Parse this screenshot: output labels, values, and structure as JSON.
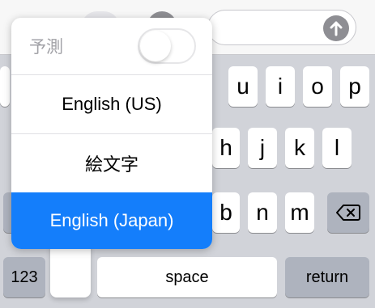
{
  "message_bar": {
    "send_icon": "arrow-up-icon"
  },
  "keyboard": {
    "row1_keys": [
      "u",
      "i",
      "o",
      "p"
    ],
    "row2_keys": [
      "h",
      "j",
      "k",
      "l"
    ],
    "row3_keys": [
      "b",
      "n",
      "m"
    ],
    "delete_icon": "delete-backspace-icon",
    "numbers_label": "123",
    "space_label": "space",
    "return_label": "return"
  },
  "language_menu": {
    "prediction_label": "予測",
    "prediction_enabled": false,
    "options": [
      {
        "label": "English (US)",
        "selected": false
      },
      {
        "label": "絵文字",
        "selected": false
      },
      {
        "label": "English (Japan)",
        "selected": true
      }
    ]
  },
  "colors": {
    "selection_blue": "#147efb",
    "keyboard_bg": "#d1d3d9",
    "function_key": "#aeb3be"
  }
}
